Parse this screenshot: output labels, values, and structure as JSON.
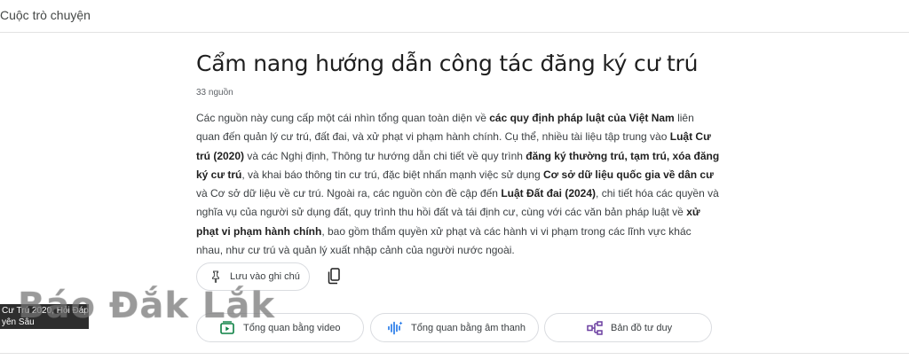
{
  "topbar": {
    "title": "Cuộc trò chuyện"
  },
  "notebook": {
    "title": "Cẩm nang hướng dẫn công tác đăng ký cư trú",
    "sources": "33 nguồn",
    "summary": [
      {
        "t": "Các nguồn này cung cấp một cái nhìn tổng quan toàn diện về ",
        "b": false
      },
      {
        "t": "các quy định pháp luật của Việt Nam",
        "b": true
      },
      {
        "t": " liên quan đến quản lý cư trú, đất đai, và xử phạt vi phạm hành chính. Cụ thể, nhiều tài liệu tập trung vào ",
        "b": false
      },
      {
        "t": "Luật Cư trú (2020)",
        "b": true
      },
      {
        "t": " và các Nghị định, Thông tư hướng dẫn chi tiết về quy trình ",
        "b": false
      },
      {
        "t": "đăng ký thường trú, tạm trú, xóa đăng ký cư trú",
        "b": true
      },
      {
        "t": ", và khai báo thông tin cư trú, đặc biệt nhấn mạnh việc sử dụng ",
        "b": false
      },
      {
        "t": "Cơ sở dữ liệu quốc gia về dân cư",
        "b": true
      },
      {
        "t": " và Cơ sở dữ liệu về cư trú. Ngoài ra, các nguồn còn đề cập đến ",
        "b": false
      },
      {
        "t": "Luật Đất đai (2024)",
        "b": true
      },
      {
        "t": ", chi tiết hóa các quyền và nghĩa vụ của người sử dụng đất, quy trình thu hồi đất và tái định cư, cùng với các văn bản pháp luật về ",
        "b": false
      },
      {
        "t": "xử phạt vi phạm hành chính",
        "b": true
      },
      {
        "t": ", bao gồm thẩm quyền xử phạt và các hành vi vi phạm trong các lĩnh vực khác nhau, như cư trú và quản lý xuất nhập cảnh của người nước ngoài.",
        "b": false
      }
    ]
  },
  "actions": {
    "save_note": "Lưu vào ghi chú",
    "copy_icon": "copy-icon"
  },
  "overviews": [
    {
      "label": "Tổng quan bằng video",
      "icon": "video-overview-icon"
    },
    {
      "label": "Tổng quan bằng âm thanh",
      "icon": "audio-waveform-icon"
    },
    {
      "label": "Bản đồ tư duy",
      "icon": "mind-map-icon"
    }
  ],
  "video_caption": [
    "Cư Trú 2020, Hỏi Đáp",
    "yên Sâu"
  ],
  "watermark": "Báo Đắk Lắk",
  "colors": {
    "accent_blue": "#1a73e8",
    "map_purple": "#6b3fa0",
    "video_green": "#0b8043"
  }
}
